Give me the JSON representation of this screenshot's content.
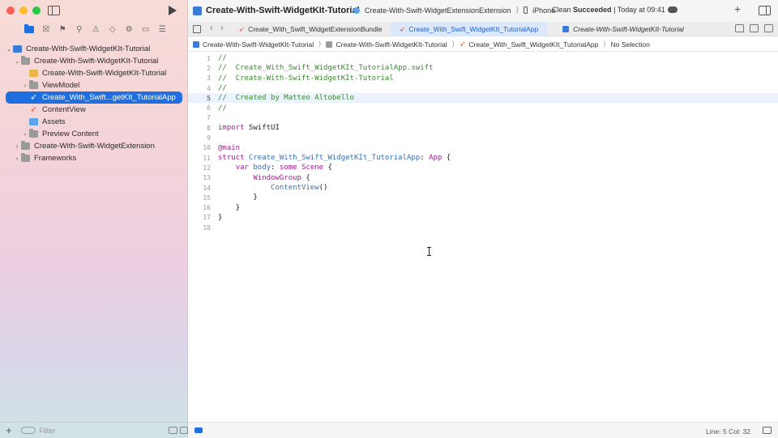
{
  "toolbar": {
    "project_title": "Create-With-Swift-WidgetKIt-Tutorial",
    "scheme_target": "Create-With-Swift-WidgetExtensionExtension",
    "scheme_separator": "⟩",
    "scheme_device": "iPhone",
    "status_prefix": "Clean",
    "status_result": "Succeeded",
    "status_time": "| Today at 09:41"
  },
  "sidebar": {
    "items": [
      {
        "label": "Create-With-Swift-WidgetKIt-Tutorial"
      },
      {
        "label": "Create-With-Swift-WidgetKIt-Tutorial"
      },
      {
        "label": "Create-With-Swift-WidgetKIt-Tutorial"
      },
      {
        "label": "ViewModel"
      },
      {
        "label": "Create_With_Swift...getKIt_TutorialApp"
      },
      {
        "label": "ContentView"
      },
      {
        "label": "Assets"
      },
      {
        "label": "Preview Content"
      },
      {
        "label": "Create-With-Swift-WidgetExtension"
      },
      {
        "label": "Frameworks"
      }
    ],
    "filter_placeholder": "Filter"
  },
  "tabs": [
    {
      "label": "Create_With_Swift_WidgetExtensionBundle"
    },
    {
      "label": "Create_With_Swift_WidgetKIt_TutorialApp"
    },
    {
      "label": "Create-With-Swift-WidgetKIt-Tutorial"
    }
  ],
  "jumpbar": {
    "project": "Create-With-Swift-WidgetKIt-Tutorial",
    "folder": "Create-With-Swift-WidgetKIt-Tutorial",
    "file": "Create_With_Swift_WidgetKIt_TutorialApp",
    "selection": "No Selection",
    "separator": "⟩"
  },
  "editor": {
    "line_numbers": [
      "1",
      "2",
      "3",
      "4",
      "5",
      "6",
      "7",
      "8",
      "9",
      "10",
      "11",
      "12",
      "13",
      "14",
      "15",
      "16",
      "17",
      "18"
    ],
    "current_line": 5,
    "code": {
      "l1": "//",
      "l2": "//  Create_With_Swift_WidgetKIt_TutorialApp.swift",
      "l3": "//  Create-With-Swift-WidgetKIt-Tutorial",
      "l4": "//",
      "l5": "//  Created by Matteo Altobello",
      "l6": "//",
      "l8_kw": "import",
      "l8_rest": " SwiftUI",
      "l10": "@main",
      "l11_kw": "struct",
      "l11_name": " Create_With_Swift_WidgetKIt_TutorialApp",
      "l11_colon": ": ",
      "l11_type": "App",
      "l11_brace": " {",
      "l12_indent": "    ",
      "l12_kw": "var",
      "l12_name": " body",
      "l12_colon": ": ",
      "l12_some": "some",
      "l12_type": " Scene",
      "l12_brace": " {",
      "l13_indent": "        ",
      "l13_type": "WindowGroup",
      "l13_brace": " {",
      "l14_indent": "            ",
      "l14_type": "ContentView",
      "l14_call": "()",
      "l15": "        }",
      "l16": "    }",
      "l17": "}"
    }
  },
  "statusbar": {
    "position": "Line: 5  Col: 32"
  }
}
